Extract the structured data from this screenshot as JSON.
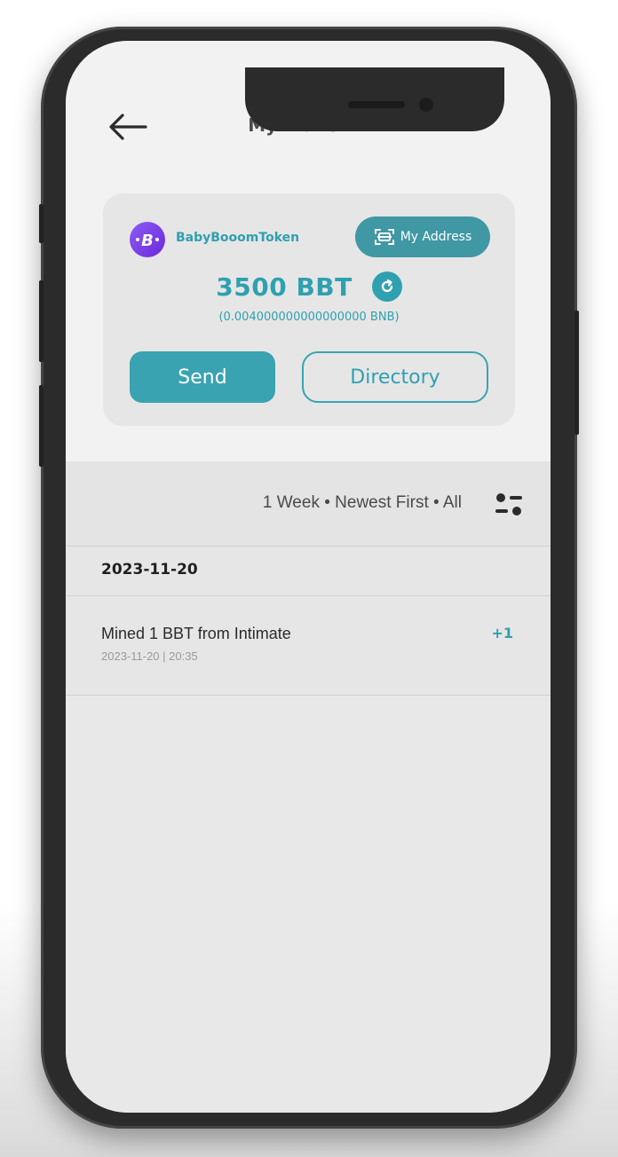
{
  "header": {
    "title": "My Wallet"
  },
  "wallet": {
    "token_name": "BabyBooomToken",
    "address_button": "My Address",
    "balance": "3500 BBT",
    "bnb_equivalent": "(0.004000000000000000 BNB)",
    "send_label": "Send",
    "directory_label": "Directory"
  },
  "filter": {
    "summary": "1 Week • Newest First • All"
  },
  "transactions": {
    "date_group": "2023-11-20",
    "items": [
      {
        "title": "Mined 1 BBT from Intimate",
        "timestamp": "2023-11-20 | 20:35",
        "amount": "+1"
      }
    ]
  },
  "colors": {
    "accent": "#2fa0b0",
    "address_button": "#3f98a4",
    "token_logo": "#7c3aed",
    "device_frame": "#2b2b2b",
    "screen_bg": "#e8e8e8"
  },
  "icons": {
    "back": "arrow-left-icon",
    "address": "scan-wallet-icon",
    "refresh": "refresh-icon",
    "filter": "sliders-icon",
    "token": "token-logo-icon"
  }
}
